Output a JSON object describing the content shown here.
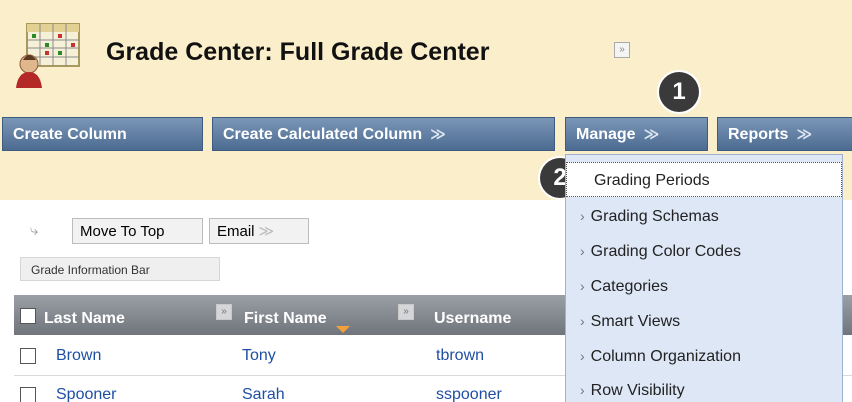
{
  "header": {
    "title": "Grade Center: Full Grade Center",
    "title_menu_icon": "chevron-down-icon"
  },
  "action_bar": {
    "create_column": "Create Column",
    "create_calculated_column": "Create Calculated Column",
    "manage": "Manage",
    "reports": "Reports"
  },
  "badges": {
    "one": "1",
    "two": "2"
  },
  "toolbar": {
    "move_to_top": "Move To Top",
    "email": "Email",
    "grade_information_bar": "Grade Information Bar"
  },
  "grid": {
    "headers": [
      "Last Name",
      "First Name",
      "Username"
    ],
    "rows": [
      {
        "last": "Brown",
        "first": "Tony",
        "username": "tbrown"
      },
      {
        "last": "Spooner",
        "first": "Sarah",
        "username": "sspooner"
      }
    ]
  },
  "manage_menu": {
    "items": [
      "Grading Periods",
      "Grading Schemas",
      "Grading Color Codes",
      "Categories",
      "Smart Views",
      "Column Organization",
      "Row Visibility"
    ],
    "active_index": 0
  },
  "colors": {
    "header_bg": "#fbeecb",
    "bar_blue": "#5b7aa0",
    "grid_header": "#858b91",
    "menu_bg": "#dde7f6",
    "link": "#1f4fa3"
  }
}
